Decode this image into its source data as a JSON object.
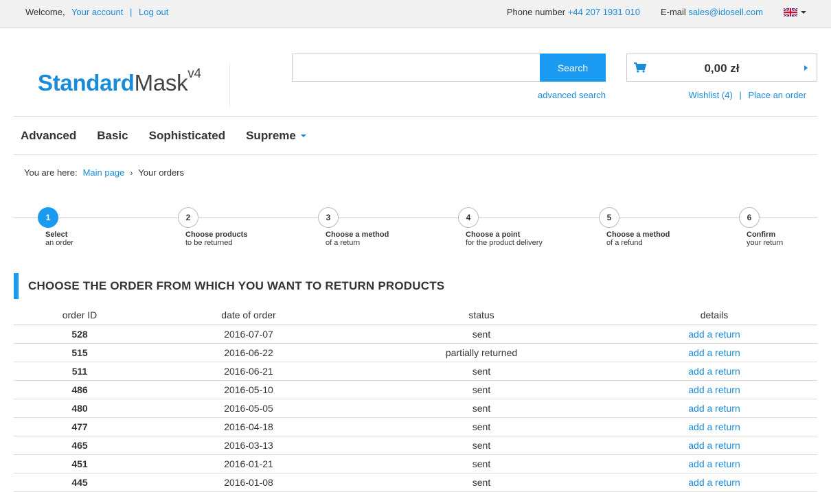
{
  "topbar": {
    "welcome": "Welcome,",
    "account_link": "Your account",
    "separator": "|",
    "logout_link": "Log out",
    "phone_label": "Phone number",
    "phone": "+44 207 1931 010",
    "email_label": "E-mail",
    "email": "sales@idosell.com",
    "language_icon": "uk-flag-icon"
  },
  "header": {
    "logo_part1": "Standard",
    "logo_part2": "Mask",
    "logo_sup": "v4",
    "search_placeholder": "",
    "search_button": "Search",
    "advanced_search": "advanced search",
    "cart_total": "0,00 zł",
    "wishlist": "Wishlist (4)",
    "place_order": "Place an order"
  },
  "nav": {
    "items": [
      "Advanced",
      "Basic",
      "Sophisticated",
      "Supreme"
    ]
  },
  "breadcrumb": {
    "label": "You are here:",
    "home": "Main page",
    "separator": "›",
    "current": "Your orders"
  },
  "steps": [
    {
      "num": "1",
      "line1": "Select",
      "line2": "an order",
      "active": true
    },
    {
      "num": "2",
      "line1": "Choose products",
      "line2": "to be returned",
      "active": false
    },
    {
      "num": "3",
      "line1": "Choose a method",
      "line2": "of a return",
      "active": false
    },
    {
      "num": "4",
      "line1": "Choose a point",
      "line2": "for the product delivery",
      "active": false
    },
    {
      "num": "5",
      "line1": "Choose a method",
      "line2": "of a refund",
      "active": false
    },
    {
      "num": "6",
      "line1": "Confirm",
      "line2": "your return",
      "active": false
    }
  ],
  "section": {
    "title": "CHOOSE THE ORDER FROM WHICH YOU WANT TO RETURN PRODUCTS"
  },
  "table": {
    "headers": [
      "order ID",
      "date of order",
      "status",
      "details"
    ],
    "rows": [
      {
        "id": "528",
        "date": "2016-07-07",
        "status": "sent",
        "details": "add a return"
      },
      {
        "id": "515",
        "date": "2016-06-22",
        "status": "partially returned",
        "details": "add a return"
      },
      {
        "id": "511",
        "date": "2016-06-21",
        "status": "sent",
        "details": "add a return"
      },
      {
        "id": "486",
        "date": "2016-05-10",
        "status": "sent",
        "details": "add a return"
      },
      {
        "id": "480",
        "date": "2016-05-05",
        "status": "sent",
        "details": "add a return"
      },
      {
        "id": "477",
        "date": "2016-04-18",
        "status": "sent",
        "details": "add a return"
      },
      {
        "id": "465",
        "date": "2016-03-13",
        "status": "sent",
        "details": "add a return"
      },
      {
        "id": "451",
        "date": "2016-01-21",
        "status": "sent",
        "details": "add a return"
      },
      {
        "id": "445",
        "date": "2016-01-08",
        "status": "sent",
        "details": "add a return"
      }
    ]
  },
  "colors": {
    "accent": "#1a9af0",
    "link": "#1a8bd8",
    "text": "#333333"
  }
}
